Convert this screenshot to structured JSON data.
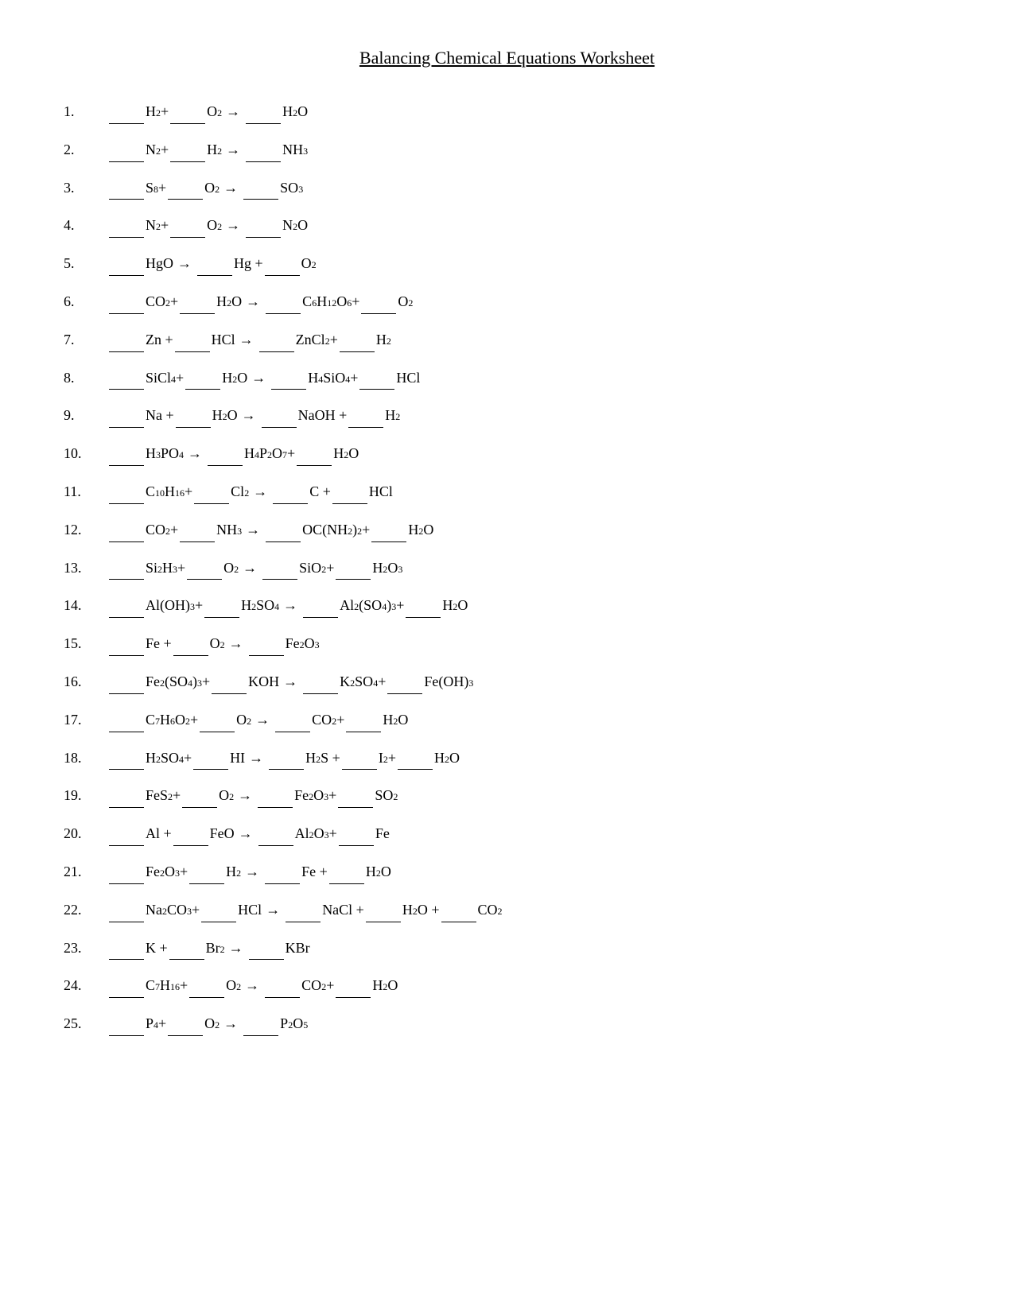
{
  "title": "Balancing Chemical Equations Worksheet",
  "equations": [
    {
      "num": "1.",
      "html": "____ H<sub>2</sub> + ____ O<sub>2</sub> → ____ H<sub>2</sub>O"
    },
    {
      "num": "2.",
      "html": "____ N<sub>2</sub>  +____ H<sub>2</sub> →____ NH<sub>3</sub>"
    },
    {
      "num": "3.",
      "html": "____ S<sub>8</sub> +  ____ O<sub>2</sub> →  ____ SO<sub>3</sub>"
    },
    {
      "num": "4.",
      "html": "____ N<sub>2</sub>  +  ____ O<sub>2</sub> →  ____ N<sub>2</sub>O"
    },
    {
      "num": "5.",
      "html": "____ HgO →  ____ Hg +  ____ O<sub>2</sub>"
    },
    {
      "num": "6.",
      "html": "____ CO<sub>2</sub>  +  ____ H<sub>2</sub>O →  ____ C<sub>6</sub>H<sub>12</sub>O<sub>6</sub>  +  ____ O<sub>2</sub>"
    },
    {
      "num": "7.",
      "html": "____ Zn +  ____ HCl →  ____ ZnCl<sub>2</sub> +  ____ H<sub>2</sub>"
    },
    {
      "num": "8.",
      "html": "____ SiCl<sub>4</sub>  +  ____ H<sub>2</sub>O →   ____ H<sub>4</sub>SiO<sub>4</sub>  +   ____ HCl"
    },
    {
      "num": "9.",
      "html": "____ Na +  ____ H<sub>2</sub>O →  ____ NaOH +  ____ H<sub>2</sub>"
    },
    {
      "num": "10.",
      "html": "____ H<sub>3</sub>PO<sub>4</sub> →  ____ H<sub>4</sub>P<sub>2</sub>O<sub>7</sub>  +  ____ H<sub>2</sub>O"
    },
    {
      "num": "11.",
      "html": "____ C<sub>10</sub>H<sub>16</sub> +  ____ Cl<sub>2</sub> →  ____ C  +  ____ HCl"
    },
    {
      "num": "12.",
      "html": "____ CO<sub>2</sub>  +  ____ NH<sub>3</sub> →  ____ OC(NH<sub>2</sub>)<sub>2</sub>  +  ____ H<sub>2</sub>O"
    },
    {
      "num": "13.",
      "html": "____ Si<sub>2</sub>H<sub>3</sub>  +  ____ O<sub>2</sub> →  ____ SiO<sub>2</sub>  +  ____ H<sub>2</sub>O<sub>3</sub>"
    },
    {
      "num": "14.",
      "html": "____ Al(OH)<sub>3</sub>  +  ____ H<sub>2</sub>SO<sub>4</sub> →  ____ Al<sub>2</sub>(SO<sub>4</sub>)<sub>3</sub>  +  ____ H<sub>2</sub>O"
    },
    {
      "num": "15.",
      "html": "____ Fe +  ____ O<sub>2</sub> →  ____ Fe<sub>2</sub>O<sub>3</sub>"
    },
    {
      "num": "16.",
      "html": "____ Fe<sub>2</sub>(SO<sub>4</sub>)<sub>3</sub>  +  ____ KOH →  ____ K<sub>2</sub>SO<sub>4</sub>  +  ____ Fe(OH)<sub>3</sub>"
    },
    {
      "num": "17.",
      "html": "____ C<sub>7</sub>H<sub>6</sub>O<sub>2</sub> +  ____ O<sub>2</sub> →  ____ CO<sub>2</sub> +  ____ H<sub>2</sub>O"
    },
    {
      "num": "18.",
      "html": "____ H<sub>2</sub>SO<sub>4</sub>  +  ____ HI  →  ____ H<sub>2</sub>S  +  ____ I<sub>2</sub>  +  ____ H<sub>2</sub>O"
    },
    {
      "num": "19.",
      "html": "____ FeS<sub>2</sub> +  ____ O<sub>2</sub> →  ____ Fe<sub>2</sub>O<sub>3</sub> +  ____ SO<sub>2</sub>"
    },
    {
      "num": "20.",
      "html": "____ Al  +  ____ FeO  →  ____ Al<sub>2</sub>O<sub>3</sub>  +  ____ Fe"
    },
    {
      "num": "21.",
      "html": "____ Fe<sub>2</sub>O<sub>3</sub>  +  ____ H<sub>2</sub> →  ____ Fe  +  ____ H<sub>2</sub>O"
    },
    {
      "num": "22.",
      "html": "____ Na<sub>2</sub>CO<sub>3</sub>  +  ____ HCl →  ____ NaCl  +  ____ H<sub>2</sub>O  +  ____ CO<sub>2</sub>"
    },
    {
      "num": "23.",
      "html": "____ K  +  ____ Br<sub>2</sub> →  ____ KBr"
    },
    {
      "num": "24.",
      "html": "____ C<sub>7</sub>H<sub>16</sub>  +   ____ O<sub>2</sub>  →  ____ CO<sub>2</sub>  +  ____ H<sub>2</sub>O"
    },
    {
      "num": "25.",
      "html": "____ P<sub>4</sub>  +  ____ O<sub>2</sub> →  ____ P<sub>2</sub>O<sub>5</sub>"
    }
  ]
}
